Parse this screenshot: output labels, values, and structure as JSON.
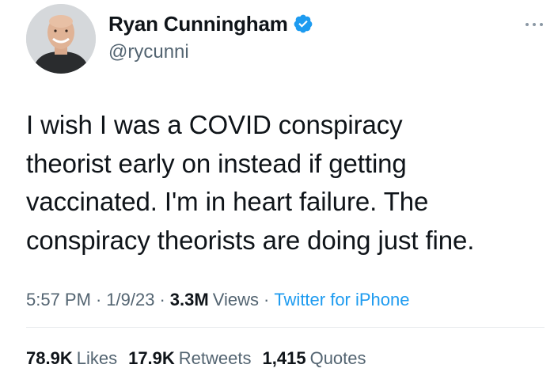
{
  "author": {
    "display_name": "Ryan Cunningham",
    "handle": "@rycunni",
    "verified": true,
    "avatar_icon": "profile-photo"
  },
  "tweet": {
    "text": "I wish I was a COVID conspiracy\ntheorist early on instead if getting\nvaccinated.  I'm in heart failure.  The\nconspiracy theorists are doing just fine."
  },
  "meta": {
    "time": "5:57 PM",
    "separator": "·",
    "date": "1/9/23",
    "views_count": "3.3M",
    "views_label": "Views",
    "source": "Twitter for iPhone"
  },
  "stats": {
    "likes_count": "78.9K",
    "likes_label": "Likes",
    "retweets_count": "17.9K",
    "retweets_label": "Retweets",
    "quotes_count": "1,415",
    "quotes_label": "Quotes"
  },
  "colors": {
    "text_primary": "#0f1419",
    "text_secondary": "#536471",
    "accent": "#1d9bf0"
  }
}
